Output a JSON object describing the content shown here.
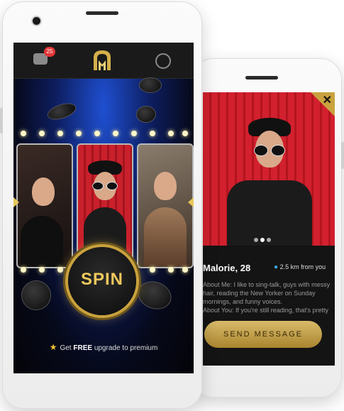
{
  "front": {
    "badge_count": "25",
    "spin_label": "SPIN",
    "promo_prefix": "Get",
    "promo_bold": "FREE",
    "promo_suffix": "upgrade to premium"
  },
  "back": {
    "profile_name": "Malorie, 28",
    "distance": "2.5 km from you",
    "about_me": "About Me: I like to sing-talk, guys with messy hair, reading the New Yorker on Sunday mornings, and funny voices.",
    "about_you": "About You: If you're still reading, that's pretty",
    "send_label": "SEND MESSAGE",
    "close_glyph": "✕",
    "carousel_dots": 3,
    "carousel_active": 1
  },
  "icons": [
    "chat-icon",
    "user-icon",
    "app-logo",
    "close-icon",
    "location-pin-icon",
    "star-icon"
  ],
  "colors": {
    "gold": "#c9a23e",
    "accent_red": "#d2202e",
    "badge_red": "#e13636",
    "pin_blue": "#3aa7e0",
    "stage_blue": "#1f4fd1"
  }
}
